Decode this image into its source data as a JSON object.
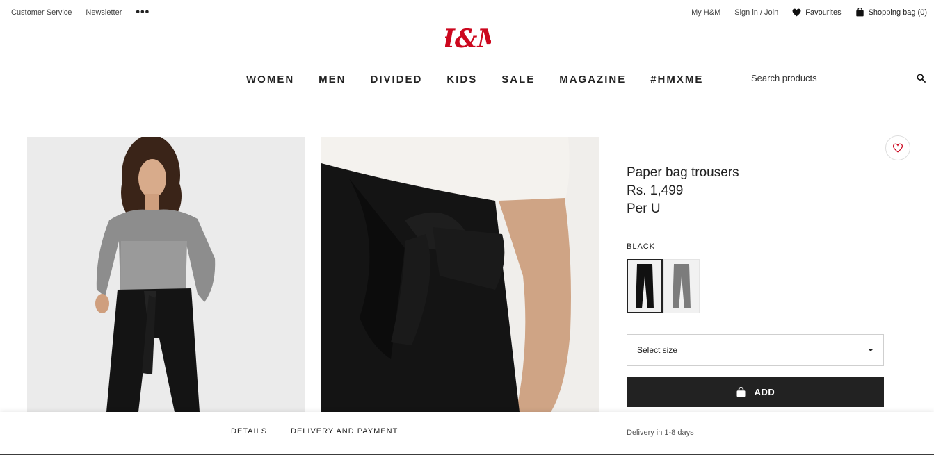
{
  "utility": {
    "customer_service": "Customer Service",
    "newsletter": "Newsletter",
    "more": "•••",
    "my_hm": "My H&M",
    "sign_in": "Sign in / Join",
    "favourites": "Favourites",
    "bag": "Shopping bag (0)"
  },
  "logo": {
    "text": "H&M",
    "color": "#cc071e"
  },
  "nav": [
    "WOMEN",
    "MEN",
    "DIVIDED",
    "KIDS",
    "SALE",
    "MAGAZINE",
    "#HMXME"
  ],
  "search": {
    "placeholder": "Search products",
    "value": ""
  },
  "product": {
    "title": "Paper bag trousers",
    "price": "Rs. 1,499",
    "unit": "Per U",
    "color_label": "BLACK",
    "swatches": [
      "black",
      "grey"
    ],
    "size_select": "Select size",
    "add_label": "ADD"
  },
  "bottom": {
    "tab_details": "DETAILS",
    "tab_delivery": "DELIVERY AND PAYMENT",
    "delivery_note": "Delivery in 1-8 days"
  },
  "colors": {
    "accent": "#cc071e",
    "dark": "#222222"
  }
}
